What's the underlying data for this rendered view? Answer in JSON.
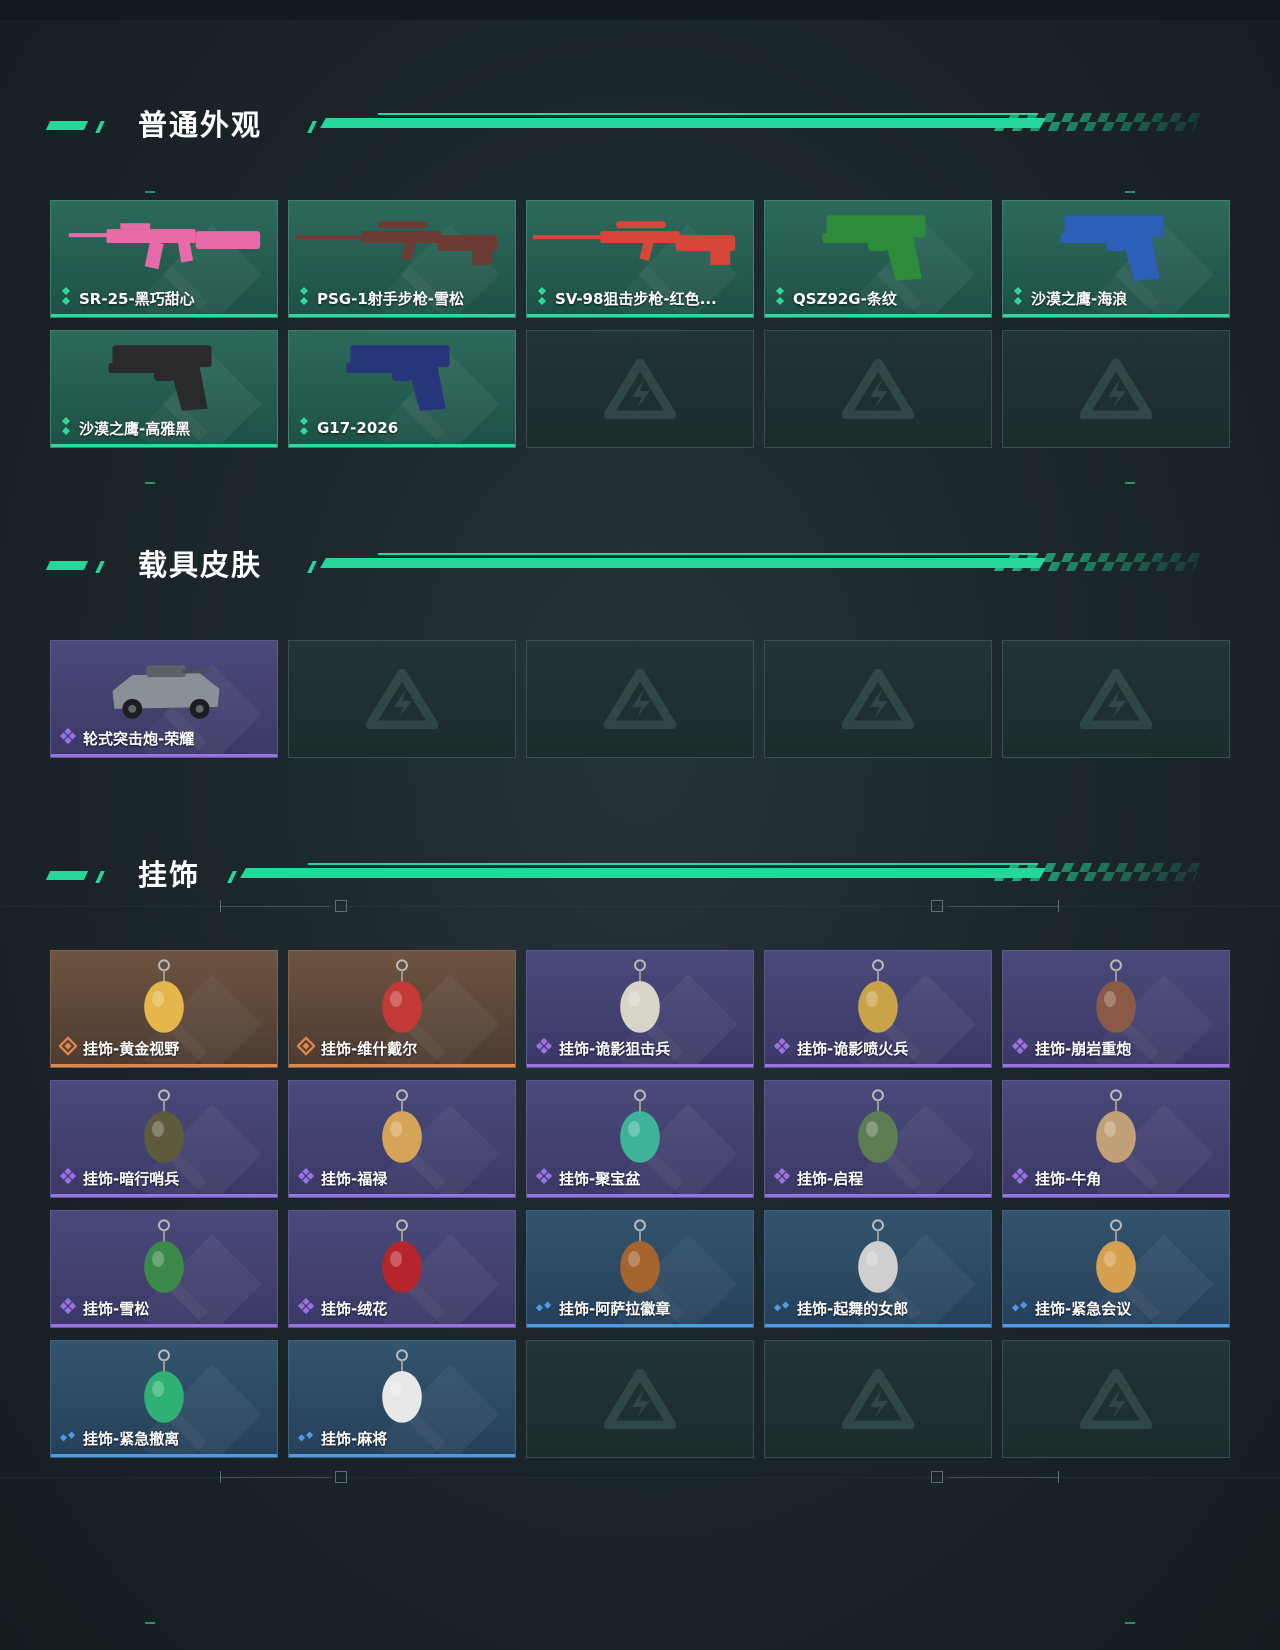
{
  "sections": {
    "weapons": {
      "title": "普通外观",
      "items": [
        {
          "label": "SR-25-黑巧甜心",
          "rarity": "green",
          "icon": "rifle-icon",
          "color": "#e86aa8"
        },
        {
          "label": "PSG-1射手步枪-雪松",
          "rarity": "green",
          "icon": "sniper-icon",
          "color": "#6b3b34"
        },
        {
          "label": "SV-98狙击步枪-红色...",
          "rarity": "green",
          "icon": "sniper-icon",
          "color": "#d8463a"
        },
        {
          "label": "QSZ92G-条纹",
          "rarity": "green",
          "icon": "pistol-icon",
          "color": "#2e8b3a"
        },
        {
          "label": "沙漠之鹰-海浪",
          "rarity": "green",
          "icon": "pistol-icon",
          "color": "#2b5fb8"
        },
        {
          "label": "沙漠之鹰-高雅黑",
          "rarity": "green",
          "icon": "pistol-icon",
          "color": "#2a2a2a"
        },
        {
          "label": "G17-2026",
          "rarity": "green",
          "icon": "pistol-icon",
          "color": "#27367a"
        }
      ],
      "slots": 10
    },
    "vehicles": {
      "title": "载具皮肤",
      "items": [
        {
          "label": "轮式突击炮-荣耀",
          "rarity": "purple",
          "icon": "vehicle-icon",
          "color": "#8a9098"
        }
      ],
      "slots": 5
    },
    "charms": {
      "title": "挂饰",
      "items": [
        {
          "label": "挂饰-黄金视野",
          "rarity": "orange",
          "icon": "charm-icon",
          "color": "#e4b64b"
        },
        {
          "label": "挂饰-维什戴尔",
          "rarity": "orange",
          "icon": "charm-icon",
          "color": "#c43a36"
        },
        {
          "label": "挂饰-诡影狙击兵",
          "rarity": "purple",
          "icon": "charm-icon",
          "color": "#d9d4c8"
        },
        {
          "label": "挂饰-诡影喷火兵",
          "rarity": "purple",
          "icon": "charm-icon",
          "color": "#c9a24a"
        },
        {
          "label": "挂饰-崩岩重炮",
          "rarity": "purple",
          "icon": "charm-icon",
          "color": "#8a5a46"
        },
        {
          "label": "挂饰-暗行哨兵",
          "rarity": "purple",
          "icon": "charm-icon",
          "color": "#5e5a3e"
        },
        {
          "label": "挂饰-福禄",
          "rarity": "purple",
          "icon": "charm-icon",
          "color": "#d6a458"
        },
        {
          "label": "挂饰-聚宝盆",
          "rarity": "purple",
          "icon": "charm-icon",
          "color": "#3fb39a"
        },
        {
          "label": "挂饰-启程",
          "rarity": "purple",
          "icon": "charm-icon",
          "color": "#5c7c52"
        },
        {
          "label": "挂饰-牛角",
          "rarity": "purple",
          "icon": "charm-icon",
          "color": "#c2a077"
        },
        {
          "label": "挂饰-雪松",
          "rarity": "purple",
          "icon": "charm-icon",
          "color": "#3c8a4a"
        },
        {
          "label": "挂饰-绒花",
          "rarity": "purple",
          "icon": "charm-icon",
          "color": "#b5262c"
        },
        {
          "label": "挂饰-阿萨拉徽章",
          "rarity": "blue",
          "icon": "charm-icon",
          "color": "#a5642e"
        },
        {
          "label": "挂饰-起舞的女郎",
          "rarity": "blue",
          "icon": "charm-icon",
          "color": "#cfcfcf"
        },
        {
          "label": "挂饰-紧急会议",
          "rarity": "blue",
          "icon": "charm-icon",
          "color": "#d6a14f"
        },
        {
          "label": "挂饰-紧急撤离",
          "rarity": "blue",
          "icon": "charm-icon",
          "color": "#2fb176"
        },
        {
          "label": "挂饰-麻将",
          "rarity": "blue",
          "icon": "charm-icon",
          "color": "#e8e8e8"
        }
      ],
      "slots": 20
    }
  },
  "colors": {
    "accent": "#26d79a",
    "green_rarity": "#2fd89b",
    "purple_rarity": "#9b72e3",
    "orange_rarity": "#e2864a",
    "blue_rarity": "#4d9be6"
  },
  "empty_slot_icon": "delta-logo-icon"
}
